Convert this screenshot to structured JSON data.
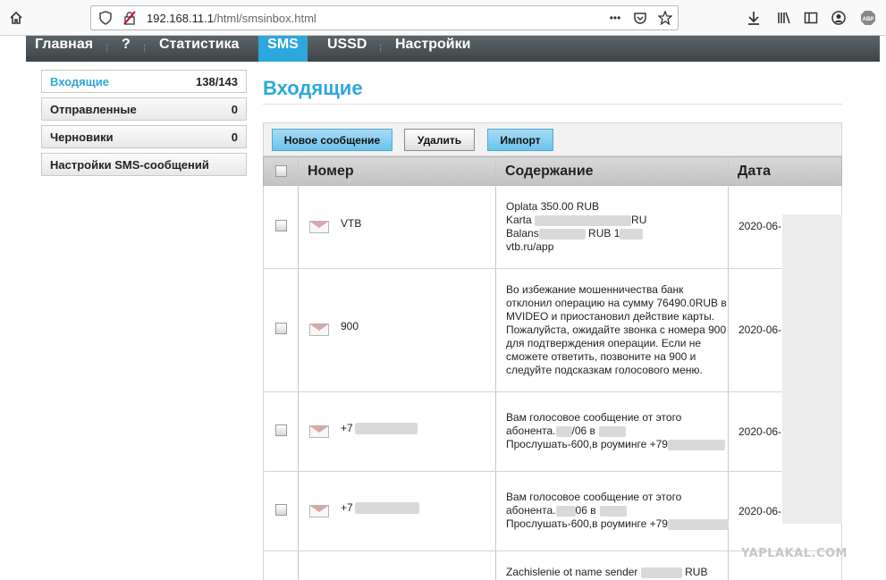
{
  "browser": {
    "url_host": "192.168.11.1",
    "url_path": "/html/smsinbox.html",
    "menu_dots": "•••"
  },
  "nav": {
    "items": [
      "Главная",
      "?",
      "Статистика",
      "SMS",
      "USSD",
      "Настройки"
    ],
    "active": "SMS"
  },
  "sidebar": {
    "items": [
      {
        "label": "Входящие",
        "count": "138/143"
      },
      {
        "label": "Отправленные",
        "count": "0"
      },
      {
        "label": "Черновики",
        "count": "0"
      },
      {
        "label": "Настройки SMS-сообщений",
        "count": ""
      }
    ]
  },
  "main": {
    "title": "Входящие",
    "buttons": {
      "new": "Новое сообщение",
      "delete": "Удалить",
      "import": "Импорт"
    },
    "columns": {
      "number": "Номер",
      "content": "Содержание",
      "date": "Дата"
    },
    "rows": [
      {
        "number": "VTB",
        "lines": [
          "Oplata 350.00 RUB",
          "Karta",
          "RU",
          "Balans",
          "RUB 1",
          "vtb.ru/app"
        ],
        "date": "2020-06-"
      },
      {
        "number": "900",
        "text": "Во избежание мошенничества банк отклонил операцию на сумму 76490.0RUB в MVIDEO и приостановил действие карты. Пожалуйста, ожидайте звонка с номера 900 для подтверждения операции. Если не сможете ответить, позвоните на 900 и следуйте подсказкам голосового меню.",
        "date": "2020-06-"
      },
      {
        "number": "+7",
        "line1": "Вам голосовое сообщение от этого",
        "line2a": "абонента.",
        "line2b": "/06 в",
        "line3": "Прослушать-600,в роуминге +79",
        "date": "2020-06-"
      },
      {
        "number": "+7",
        "line1": "Вам голосовое сообщение от этого",
        "line2a": "абонента.",
        "line2b": "06 в",
        "line3": "Прослушать-600,в роуминге +79",
        "date": "2020-06-"
      },
      {
        "number": "",
        "line1a": "Zachislenie ot name sender",
        "line1b": "RUB",
        "date": ""
      }
    ]
  },
  "watermark": "YAPLAKAL.COM"
}
